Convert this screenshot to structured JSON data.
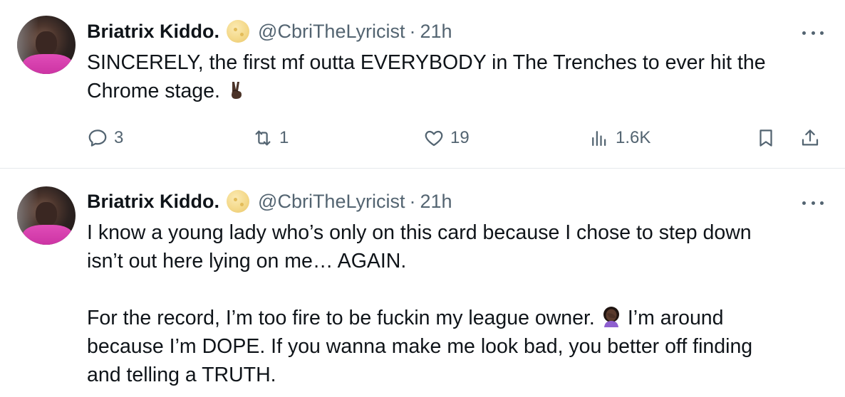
{
  "tweets": [
    {
      "author_name": "Briatrix Kiddo.",
      "handle": "@CbriTheLyricist",
      "separator": "·",
      "time": "21h",
      "text_lines": [
        "SINCERELY, the first mf outta EVERYBODY in The Trenches to ever hit the",
        "Chrome stage."
      ],
      "emoji": "victory-hand-dark-skin",
      "stats": {
        "replies": "3",
        "reposts": "1",
        "likes": "19",
        "views": "1.6K"
      },
      "icons": [
        "reply-icon",
        "repost-icon",
        "like-icon",
        "views-icon",
        "bookmark-icon",
        "share-icon"
      ]
    },
    {
      "author_name": "Briatrix Kiddo.",
      "handle": "@CbriTheLyricist",
      "separator": "·",
      "time": "21h",
      "paragraph1": [
        "I know a young lady who’s only on this card because I chose to step down",
        "isn’t out here lying on me… AGAIN."
      ],
      "paragraph2_line1_a": "For the record, I’m too fire to be fuckin my league owner.",
      "paragraph2_line1_b": "I’m around",
      "emoji": "woman-facepalming-dark-skin",
      "paragraph2_rest": [
        "because I’m DOPE. If you wanna make me look bad, you better off finding",
        "and telling a TRUTH."
      ]
    }
  ],
  "colors": {
    "text_primary": "#0f1419",
    "text_secondary": "#536471",
    "divider": "#e6e9ec",
    "verified_badge": "#f4d98a",
    "avatar_accent": "#d63aab"
  }
}
